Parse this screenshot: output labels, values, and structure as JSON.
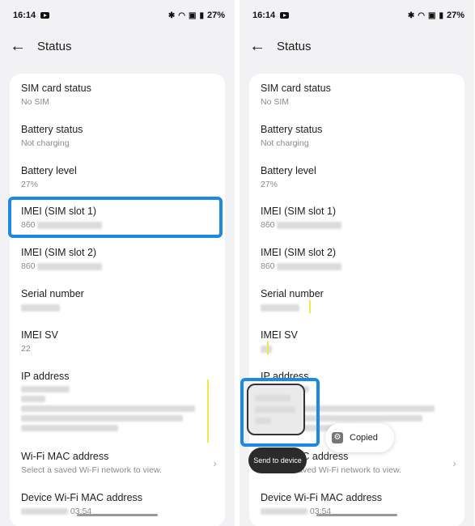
{
  "status_bar": {
    "time": "16:14",
    "battery": "27%"
  },
  "app_bar": {
    "title": "Status"
  },
  "items": {
    "sim_status": {
      "title": "SIM card status",
      "value": "No SIM"
    },
    "battery_status": {
      "title": "Battery status",
      "value": "Not charging"
    },
    "battery_level": {
      "title": "Battery level",
      "value": "27%"
    },
    "imei1": {
      "title": "IMEI (SIM slot 1)",
      "value_prefix": "860"
    },
    "imei2": {
      "title": "IMEI (SIM slot 2)",
      "value_prefix": "860"
    },
    "serial": {
      "title": "Serial number"
    },
    "imei_sv": {
      "title": "IMEI SV",
      "value": "22"
    },
    "ip": {
      "title": "IP address"
    },
    "wifi_mac": {
      "title": "Wi-Fi MAC address",
      "value": "Select a saved Wi-Fi network to view."
    },
    "device_mac": {
      "title": "Device Wi-Fi MAC address",
      "value_fragment": "03:54"
    }
  },
  "toast": {
    "label": "Copied"
  },
  "popup": {
    "send_label": "Send to device"
  },
  "colors": {
    "highlight": "#1e88e5",
    "marker": "#f2e64a",
    "background": "#f2f2f4"
  },
  "icons": {
    "back": "back-arrow-icon",
    "toast": "copy-icon",
    "chevron": "chevron-right-icon",
    "status": [
      "bluetooth-icon",
      "wifi-icon",
      "battery-saver-icon",
      "battery-icon"
    ]
  }
}
